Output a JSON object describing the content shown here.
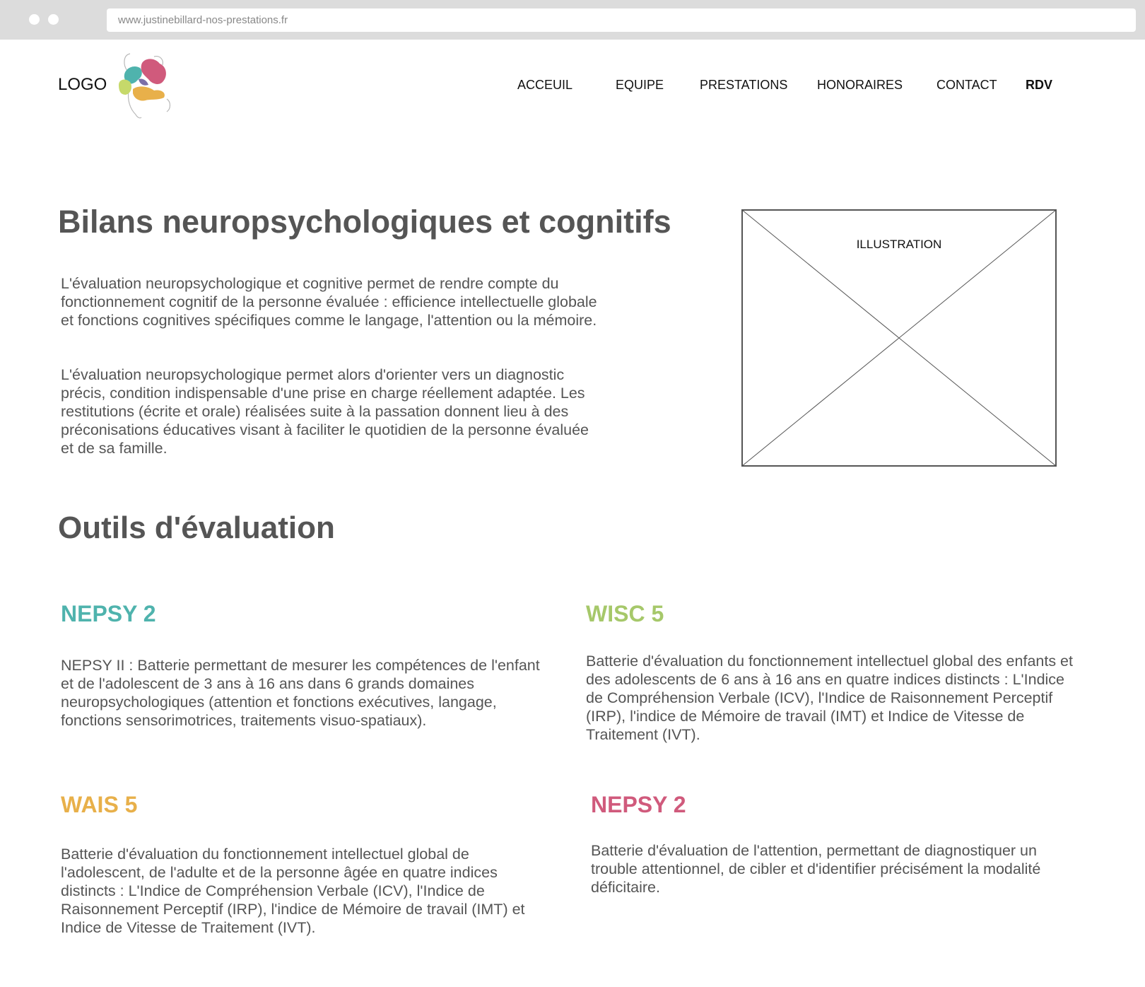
{
  "browser": {
    "url": "www.justinebillard-nos-prestations.fr"
  },
  "header": {
    "logo_text": "LOGO",
    "logo_icon": "brain-puzzle-icon",
    "nav": [
      "ACCEUIL",
      "EQUIPE",
      "PRESTATIONS",
      "HONORAIRES",
      "CONTACT",
      "RDV"
    ]
  },
  "intro": {
    "title": "Bilans neuropsychologiques et cognitifs",
    "paragraphs": [
      "L'évaluation neuropsychologique et cognitive permet de rendre compte du fonctionnement cognitif de la personne évaluée : efficience intellectuelle globale et fonctions cognitives spécifiques comme le langage, l'attention ou la mémoire.",
      "L'évaluation neuropsychologique permet alors d'orienter vers un diagnostic précis, condition indispensable d'une prise en charge réellement adaptée. Les restitutions (écrite et orale) réalisées suite à la passation donnent lieu à des préconisations éducatives visant à faciliter le quotidien de la personne évaluée et de sa famille."
    ],
    "illustration_label": "ILLUSTRATION"
  },
  "tools": {
    "title": "Outils d'évaluation",
    "items": [
      {
        "title": "NEPSY 2",
        "color": "#4fb3ad",
        "text": "NEPSY II : Batterie permettant de mesurer les compétences de l'enfant et de l'adolescent de 3 ans à 16 ans dans 6 grands domaines neuropsychologiques (attention et fonctions exécutives, langage, fonctions sensorimotrices, traitements visuo-spatiaux)."
      },
      {
        "title": "WISC 5",
        "color": "#a6c86a",
        "text": "Batterie d'évaluation du fonctionnement intellectuel global des enfants et des adolescents de 6 ans à 16 ans en quatre indices distincts : L'Indice de Compréhension Verbale (ICV), l'Indice de Raisonnement Perceptif (IRP), l'indice de Mémoire de travail (IMT) et Indice de Vitesse de Traitement (IVT)."
      },
      {
        "title": "WAIS 5",
        "color": "#e8b04a",
        "text": "Batterie d'évaluation du fonctionnement intellectuel global de l'adolescent, de l'adulte et de la personne âgée en quatre indices distincts : L'Indice de Compréhension Verbale (ICV), l'Indice de Raisonnement Perceptif (IRP), l'indice de Mémoire de travail (IMT) et Indice de Vitesse de Traitement (IVT)."
      },
      {
        "title": "NEPSY 2",
        "color": "#d05a7c",
        "text": "Batterie d'évaluation de l'attention, permettant de diagnostiquer un trouble attentionnel, de cibler et d'identifier précisément la modalité déficitaire."
      }
    ]
  }
}
